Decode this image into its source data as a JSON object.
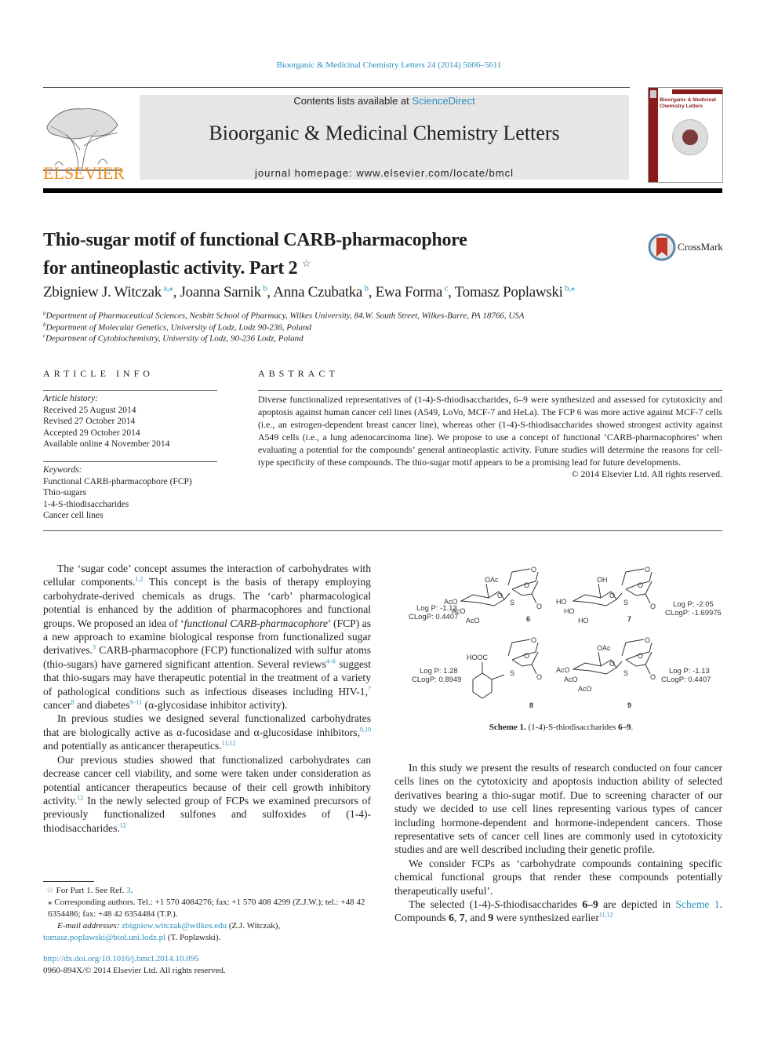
{
  "header": {
    "citation": "Bioorganic & Medicinal Chemistry Letters 24 (2014) 5606–5611",
    "contents_prefix": "Contents lists available at ",
    "contents_link": "ScienceDirect",
    "journal_title": "Bioorganic & Medicinal Chemistry Letters",
    "homepage": "journal homepage: www.elsevier.com/locate/bmcl",
    "publisher": "ELSEVIER",
    "cover_title_line1": "Bioorganic & Medicinal",
    "cover_title_line2": "Chemistry Letters",
    "crossmark_label": "CrossMark",
    "colors": {
      "link": "#2a8fbd",
      "elsevier_orange": "#f08a1c",
      "cover_red": "#8b1a1a"
    }
  },
  "article": {
    "title_line1": "Thio-sugar motif of functional CARB-pharmacophore",
    "title_line2": "for antineoplastic activity. Part 2",
    "title_note_symbol": "☆",
    "authors": [
      {
        "name": "Zbigniew J. Witczak",
        "sup": "a,⁎",
        "sep": ", "
      },
      {
        "name": "Joanna Sarnik",
        "sup": "b",
        "sep": ", "
      },
      {
        "name": "Anna Czubatka",
        "sup": "b",
        "sep": ", "
      },
      {
        "name": "Ewa Forma",
        "sup": "c",
        "sep": ", "
      },
      {
        "name": "Tomasz Poplawski",
        "sup": "b,⁎",
        "sep": ""
      }
    ],
    "affiliations": [
      {
        "key": "a",
        "text": "Department of Pharmaceutical Sciences, Nesbitt School of Pharmacy, Wilkes University, 84.W. South Street, Wilkes-Barre, PA 18766, USA"
      },
      {
        "key": "b",
        "text": "Department of Molecular Genetics, University of Lodz, Lodz 90-236, Poland"
      },
      {
        "key": "c",
        "text": "Department of Cytobiochemistry, University of Lodz, 90-236 Lodz, Poland"
      }
    ]
  },
  "article_info": {
    "heading": "ARTICLE INFO",
    "history_label": "Article history:",
    "history": [
      "Received 25 August 2014",
      "Revised 27 October 2014",
      "Accepted 29 October 2014",
      "Available online 4 November 2014"
    ],
    "keywords_label": "Keywords:",
    "keywords": [
      "Functional CARB-pharmacophore (FCP)",
      "Thio-sugars",
      "1-4-S-thiodisaccharides",
      "Cancer cell lines"
    ]
  },
  "abstract": {
    "heading": "ABSTRACT",
    "text": "Diverse functionalized representatives of (1-4)-S-thiodisaccharides, 6–9 were synthesized and assessed for cytotoxicity and apoptosis against human cancer cell lines (A549, LoVo, MCF-7 and HeLa). The FCP 6 was more active against MCF-7 cells (i.e., an estrogen-dependent breast cancer line), whereas other (1-4)-S-thiodisaccharides showed strongest activity against A549 cells (i.e., a lung adenocarcinoma line). We propose to use a concept of functional ‘CARB-pharmacophores’ when evaluating a potential for the compounds’ general antineoplastic activity. Future studies will determine the reasons for cell-type specificity of these compounds. The thio-sugar motif appears to be a promising lead for future developments.",
    "copyright": "© 2014 Elsevier Ltd. All rights reserved."
  },
  "body": {
    "left": [
      {
        "parts": [
          {
            "t": "The ‘sugar code’ concept assumes the interaction of carbohydrates with cellular components."
          },
          {
            "sup": "1,2"
          },
          {
            "t": " This concept is the basis of therapy employing carbohydrate-derived chemicals as drugs. The ‘carb’ pharmacological potential is enhanced by the addition of pharmacophores and functional groups. We proposed an idea of ‘"
          },
          {
            "i": "functional CARB-pharmacophore"
          },
          {
            "t": "’ (FCP) as a new approach to examine biological response from functionalized sugar derivatives."
          },
          {
            "sup": "3"
          },
          {
            "t": " CARB-pharmacophore (FCP) functionalized with sulfur atoms (thio-sugars) have garnered significant attention. Several reviews"
          },
          {
            "sup": "4–6"
          },
          {
            "t": " suggest that thio-sugars may have therapeutic potential in the treatment of a variety of pathological conditions such as infectious diseases including HIV-1,"
          },
          {
            "sup": "7"
          },
          {
            "t": " cancer"
          },
          {
            "sup": "8"
          },
          {
            "t": " and diabetes"
          },
          {
            "sup": "9–11"
          },
          {
            "t": " (α-glycosidase inhibitor activity)."
          }
        ]
      },
      {
        "parts": [
          {
            "t": "In previous studies we designed several functionalized carbohydrates that are biologically active as α-fucosidase and α-glucosidase inhibitors,"
          },
          {
            "sup": "9,10"
          },
          {
            "t": " and potentially as anticancer therapeutics."
          },
          {
            "sup": "11,12"
          }
        ]
      },
      {
        "parts": [
          {
            "t": "Our previous studies showed that functionalized carbohydrates can decrease cancer cell viability, and some were taken under consideration as potential anticancer therapeutics because of their cell growth inhibitory activity."
          },
          {
            "sup": "12"
          },
          {
            "t": " In the newly selected group of FCPs we examined precursors of previously functionalized sulfones and sulfoxides of (1-4)-thiodisaccharides."
          },
          {
            "sup": "12"
          }
        ]
      }
    ],
    "right": [
      {
        "parts": [
          {
            "t": "In this study we present the results of research conducted on four cancer cells lines on the cytotoxicity and apoptosis induction ability of selected derivatives bearing a thio-sugar motif. Due to screening character of our study we decided to use cell lines representing various types of cancer including hormone-dependent and hormone-independent cancers. Those representative sets of cancer cell lines are commonly used in cytotoxicity studies and are well described including their genetic profile."
          }
        ]
      },
      {
        "parts": [
          {
            "t": "We consider FCPs as ‘carbohydrate compounds containing specific chemical functional groups that render these compounds potentially therapeutically useful’."
          }
        ]
      },
      {
        "parts": [
          {
            "t": "The selected (1-4)-"
          },
          {
            "i": "S"
          },
          {
            "t": "-thiodisaccharides "
          },
          {
            "b": "6–9"
          },
          {
            "t": " are depicted in "
          },
          {
            "link": "Scheme 1"
          },
          {
            "t": ". Compounds "
          },
          {
            "b": "6"
          },
          {
            "t": ", "
          },
          {
            "b": "7"
          },
          {
            "t": ", and "
          },
          {
            "b": "9"
          },
          {
            "t": " were synthesized earlier"
          },
          {
            "sup": "11,12"
          }
        ]
      }
    ]
  },
  "scheme": {
    "caption_label": "Scheme 1.",
    "caption_text": " (1-4)-S-thiodisaccharides ",
    "caption_range": "6–9",
    "compounds": [
      {
        "id": "6",
        "logp": "Log P: -1.13",
        "clogp": "CLogP: 0.4407",
        "subs": [
          "OAc",
          "AcO",
          "AcO",
          "AcO"
        ]
      },
      {
        "id": "7",
        "logp": "Log P: -2.05",
        "clogp": "CLogP: -1.69975",
        "subs": [
          "OH",
          "HO",
          "HO",
          "HO"
        ]
      },
      {
        "id": "8",
        "logp": "Log P: 1.28",
        "clogp": "CLogP: 0.8949",
        "subs": [
          "HOOC"
        ]
      },
      {
        "id": "9",
        "logp": "Log P: -1.13",
        "clogp": "CLogP: 0.4407",
        "subs": [
          "OAc",
          "AcO",
          "AcO",
          "AcO"
        ]
      }
    ],
    "atom_labels": {
      "O": "O",
      "S": "S"
    }
  },
  "footnotes": {
    "star_note_prefix": "For Part 1. See Ref. ",
    "star_note_ref": "3",
    "corr_note": "Corresponding authors. Tel.: +1 570 4084276; fax: +1 570 408 4299 (Z.J.W.); tel.: +48 42 6354486; fax: +48 42 6354484 (T.P.).",
    "email_label": "E-mail addresses: ",
    "email1": "zbigniew.witczak@wilkes.edu",
    "email1_owner": " (Z.J. Witczak), ",
    "email2": "tomasz.poplawski@biol.uni.lodz.pl",
    "email2_owner": " (T. Poplawski).",
    "doi": "http://dx.doi.org/10.1016/j.bmcl.2014.10.095",
    "issn": "0960-894X/© 2014 Elsevier Ltd. All rights reserved."
  }
}
